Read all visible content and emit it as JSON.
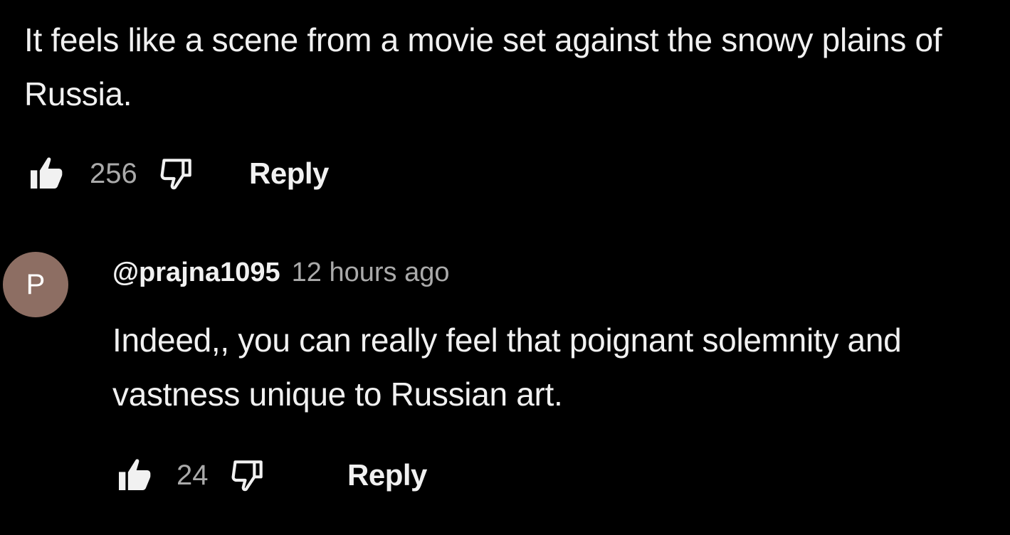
{
  "comment": {
    "text": "It feels like a scene from a movie set against the snowy plains of Russia.",
    "like_icon": "thumbs-up-icon",
    "dislike_icon": "thumbs-down-icon",
    "likes": "256",
    "reply_label": "Reply"
  },
  "reply": {
    "avatar_letter": "P",
    "avatar_color": "#8d6e63",
    "handle": "@prajna1095",
    "timestamp": "12 hours ago",
    "text": "Indeed,, you can really feel that poignant solemnity and vastness unique to Russian art.",
    "like_icon": "thumbs-up-icon",
    "dislike_icon": "thumbs-down-icon",
    "likes": "24",
    "reply_label": "Reply"
  },
  "colors": {
    "background": "#000000",
    "primary_text": "#f1f1f1",
    "secondary_text": "#aaaaaa"
  }
}
